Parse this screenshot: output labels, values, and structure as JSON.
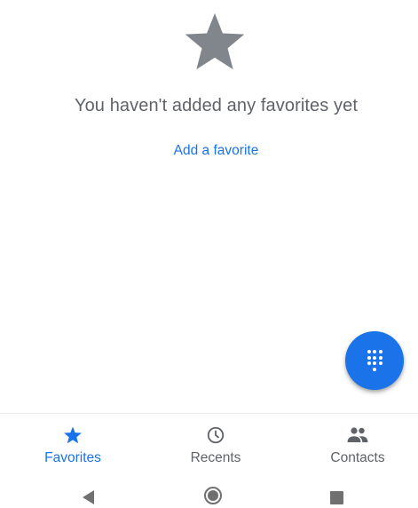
{
  "empty_state": {
    "icon": "star-icon",
    "message": "You haven't added any favorites yet",
    "add_link": "Add a favorite"
  },
  "fab": {
    "icon": "dialpad-icon",
    "color": "#1a73e8"
  },
  "bottom_nav": {
    "items": [
      {
        "label": "Favorites",
        "icon": "star-icon",
        "active": true
      },
      {
        "label": "Recents",
        "icon": "clock-icon",
        "active": false
      },
      {
        "label": "Contacts",
        "icon": "people-icon",
        "active": false
      }
    ]
  },
  "system_nav": {
    "icons": [
      "back-icon",
      "home-icon",
      "overview-icon"
    ]
  },
  "colors": {
    "accent": "#1a73e8",
    "muted_text": "#5f6368",
    "star_gray": "#80868b"
  }
}
